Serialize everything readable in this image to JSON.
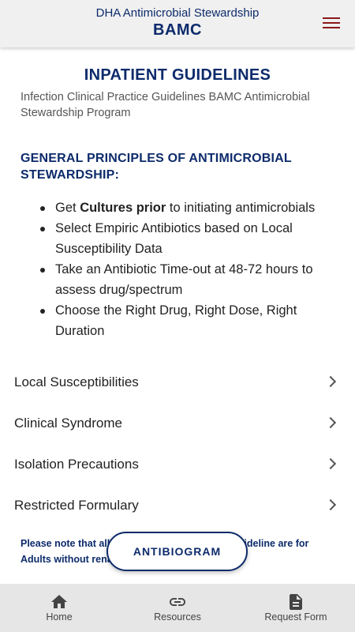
{
  "header": {
    "org": "DHA Antimicrobial Stewardship",
    "title": "BAMC",
    "menu_icon": "hamburger-menu-icon"
  },
  "page": {
    "title": "INPATIENT GUIDELINES",
    "subtitle": "Infection Clinical Practice Guidelines BAMC Antimicrobial Stewardship Program"
  },
  "principles": {
    "heading": "GENERAL PRINCIPLES OF ANTIMICROBIAL STEWARDSHIP:",
    "items": [
      {
        "before": "Get ",
        "bold": "Cultures prior",
        "after": " to initiating antimicrobials"
      },
      {
        "text": "Select Empiric Antibiotics based on Local Susceptibility Data"
      },
      {
        "text": "Take an Antibiotic Time-out at 48-72 hours to assess drug/spectrum"
      },
      {
        "text": "Choose the Right Drug, Right Dose, Right Duration"
      }
    ]
  },
  "nav": {
    "items": [
      {
        "label": "Local Susceptibilities"
      },
      {
        "label": "Clinical Syndrome"
      },
      {
        "label": "Isolation Precautions"
      },
      {
        "label": "Restricted Formulary"
      }
    ]
  },
  "note": {
    "text": "Please note that all recommendations in this guideline are for Adults without renal impairment."
  },
  "fab": {
    "label": "ANTIBIOGRAM"
  },
  "bottom_nav": {
    "tabs": [
      {
        "label": "Home",
        "icon": "home-icon"
      },
      {
        "label": "Resources",
        "icon": "link-icon"
      },
      {
        "label": "Request Form",
        "icon": "document-icon"
      }
    ]
  },
  "colors": {
    "primary": "#0d2b6b",
    "menu_accent": "#8b1a1a",
    "header_bg": "#f0f0f0",
    "bottom_nav_bg": "#e6e6e6"
  }
}
